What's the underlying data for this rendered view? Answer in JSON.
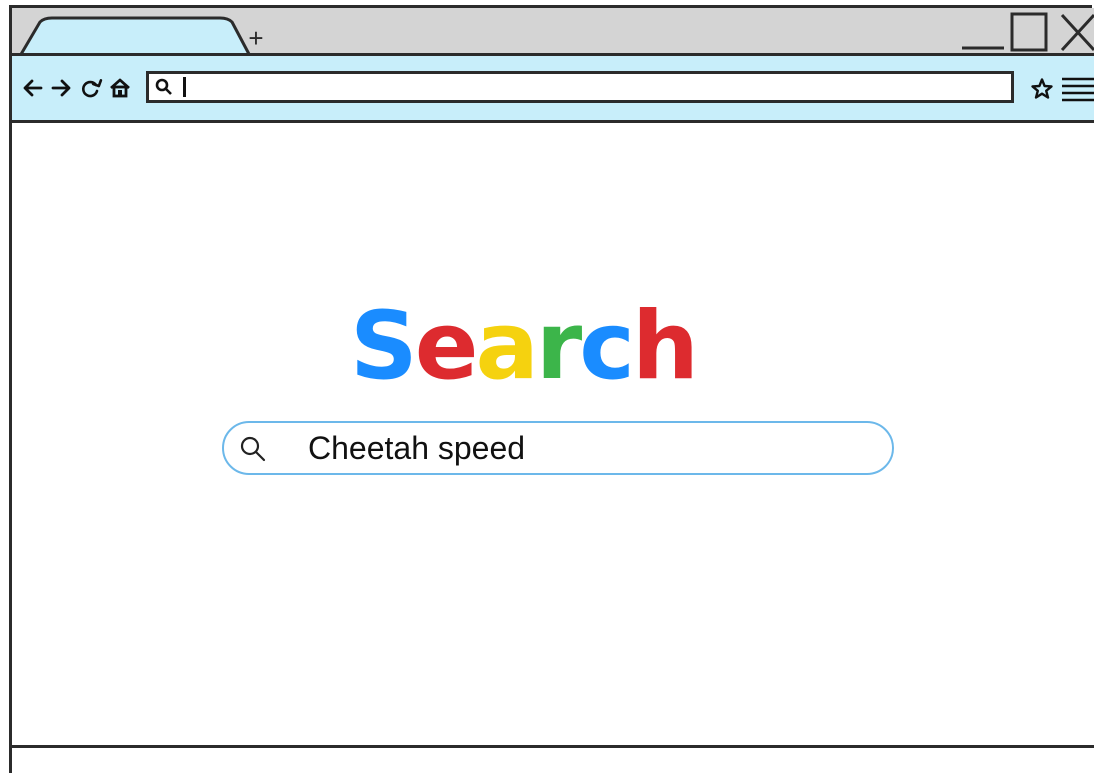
{
  "browser": {
    "new_tab_label": "+",
    "address_bar": {
      "value": ""
    }
  },
  "logo": {
    "letters": [
      {
        "char": "S",
        "color": "#1a8cff"
      },
      {
        "char": "e",
        "color": "#dd2b2f"
      },
      {
        "char": "a",
        "color": "#f5d20f"
      },
      {
        "char": "r",
        "color": "#3cb54a"
      },
      {
        "char": "c",
        "color": "#1a8cff"
      },
      {
        "char": "h",
        "color": "#dd2b2f"
      }
    ]
  },
  "search": {
    "query": "Cheetah speed"
  },
  "icons": {
    "back": "arrow-left-icon",
    "forward": "arrow-right-icon",
    "reload": "reload-icon",
    "home": "home-icon",
    "address_search": "search-icon",
    "bookmark": "star-icon",
    "menu": "hamburger-menu-icon",
    "minimize": "minimize-icon",
    "maximize": "maximize-icon",
    "close": "close-icon"
  },
  "colors": {
    "tabstrip": "#d4d4d4",
    "toolbar": "#c8eefa",
    "active_tab": "#c8eefa",
    "search_border": "#6cb8ea"
  }
}
